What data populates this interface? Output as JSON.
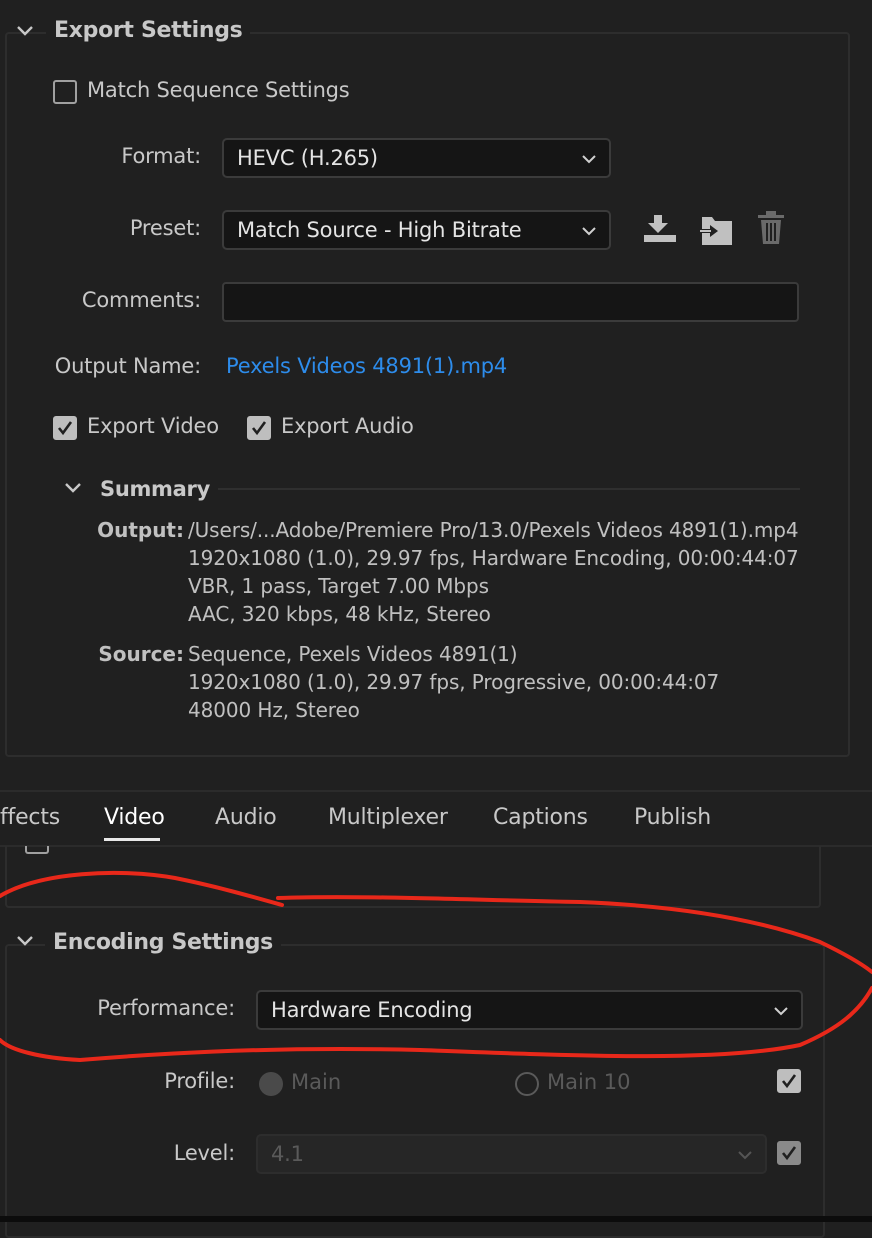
{
  "export_settings": {
    "title": "Export Settings",
    "match_sequence_label": "Match Sequence Settings",
    "match_sequence_checked": false,
    "format_label": "Format:",
    "format_value": "HEVC (H.265)",
    "preset_label": "Preset:",
    "preset_value": "Match Source - High Bitrate",
    "preset_icons": [
      "save-preset-icon",
      "import-preset-icon",
      "delete-preset-icon"
    ],
    "comments_label": "Comments:",
    "comments_value": "",
    "output_name_label": "Output Name:",
    "output_name_value": "Pexels Videos 4891(1).mp4",
    "export_video_label": "Export Video",
    "export_video_checked": true,
    "export_audio_label": "Export Audio",
    "export_audio_checked": true
  },
  "summary": {
    "title": "Summary",
    "output_label": "Output:",
    "output_lines": [
      "/Users/...Adobe/Premiere Pro/13.0/Pexels Videos 4891(1).mp4",
      "1920x1080 (1.0), 29.97 fps, Hardware Encoding, 00:00:44:07",
      "VBR, 1 pass, Target 7.00 Mbps",
      "AAC, 320 kbps, 48 kHz, Stereo"
    ],
    "source_label": "Source:",
    "source_lines": [
      "Sequence, Pexels Videos 4891(1)",
      "1920x1080 (1.0), 29.97 fps, Progressive, 00:00:44:07",
      "48000 Hz, Stereo"
    ]
  },
  "tabs": {
    "items": [
      "ffects",
      "Video",
      "Audio",
      "Multiplexer",
      "Captions",
      "Publish"
    ],
    "active": "Video"
  },
  "encoding": {
    "title": "Encoding Settings",
    "performance_label": "Performance:",
    "performance_value": "Hardware Encoding",
    "profile_label": "Profile:",
    "profile_options": [
      "Main",
      "Main 10"
    ],
    "profile_selected": "Main",
    "profile_override_checked": true,
    "level_label": "Level:",
    "level_value": "4.1",
    "level_override_checked": true
  },
  "colors": {
    "background": "#202020",
    "link": "#2d8ceb",
    "annotation": "#e8281a"
  }
}
